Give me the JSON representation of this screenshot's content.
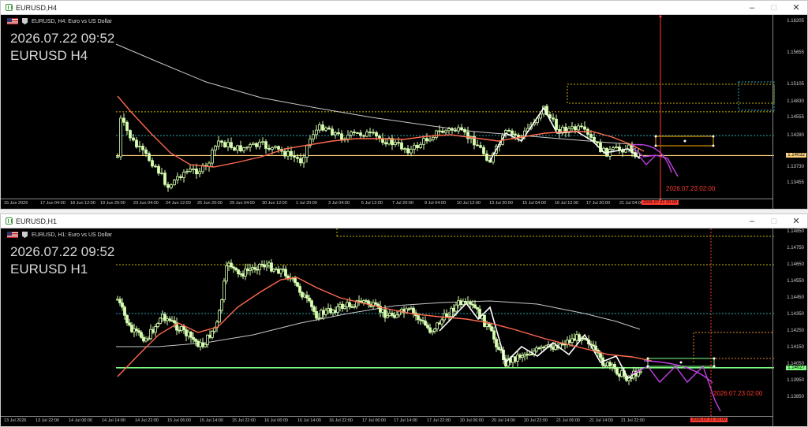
{
  "top": {
    "window_title": "EURUSD,H4",
    "info": "EURUSD, H4:  Euro vs US Dollar",
    "overlay_datetime": "2026.07.22 09:52",
    "overlay_symbol": "EURUSD H4",
    "price_labels": [
      "1.16205",
      "1.15655",
      "1.15105",
      "1.14830",
      "1.14555",
      "1.14280",
      "1.13730",
      "1.13455"
    ],
    "current_price": "1.14032",
    "time_labels": [
      "15 Jun 2026",
      "17 Jun 04:00",
      "18 Jun 12:00",
      "19 Jun 20:00",
      "23 Jun 04:00",
      "24 Jun 12:00",
      "25 Jun 20:00",
      "29 Jun 04:00",
      "30 Jun 12:00",
      "1 Jul 20:00",
      "3 Jul 04:00",
      "6 Jul 12:00",
      "7 Jul 20:00",
      "9 Jul 04:00",
      "10 Jul 12:00",
      "13 Jul 20:00",
      "15 Jul 04:00",
      "16 Jul 12:00",
      "17 Jul 20:00",
      "21 Jul 04:00"
    ],
    "time_tag": "2026.07.22 20:00",
    "vline_label": "2026.07.23 02:00",
    "colors": {
      "ma_fast": "#ff6a4d",
      "ma_slow": "#c8c8c8",
      "projection": "#c040e0",
      "price_line": "#ffd27f",
      "vline": "#ff3b30",
      "dotted_cyan": "#2aa6b5",
      "dotted_yellow": "#c8b400"
    }
  },
  "bottom": {
    "window_title": "EURUSD,H1",
    "info": "EURUSD, H1:  Euro vs US Dollar",
    "overlay_datetime": "2026.07.22 09:52",
    "overlay_symbol": "EURUSD H1",
    "price_labels": [
      "1.14850",
      "1.14750",
      "1.14650",
      "1.14550",
      "1.14450",
      "1.14350",
      "1.14250",
      "1.14150",
      "1.14050",
      "1.13950",
      "1.13850"
    ],
    "current_price": "1.14027",
    "time_labels": [
      "13 Jul 2026",
      "13 Jul 22:00",
      "14 Jul 06:00",
      "14 Jul 14:00",
      "14 Jul 22:00",
      "15 Jul 06:00",
      "15 Jul 14:00",
      "15 Jul 22:00",
      "16 Jul 06:00",
      "16 Jul 14:00",
      "16 Jul 22:00",
      "17 Jul 06:00",
      "17 Jul 14:00",
      "17 Jul 22:00",
      "20 Jul 06:00",
      "20 Jul 14:00",
      "20 Jul 22:00",
      "21 Jul 06:00",
      "21 Jul 14:00",
      "21 Jul 22:00"
    ],
    "time_tag": "2026.07.22 20:00",
    "vline_label": "2026.07.23 02:00",
    "colors": {
      "ma_fast": "#ff6a4d",
      "ma_slow": "#c8c8c8",
      "projection": "#c040e0",
      "price_line": "#7fff7f",
      "vline": "#ff3b30",
      "dotted_cyan": "#2aa6b5",
      "dotted_yellow": "#c8b400"
    }
  }
}
